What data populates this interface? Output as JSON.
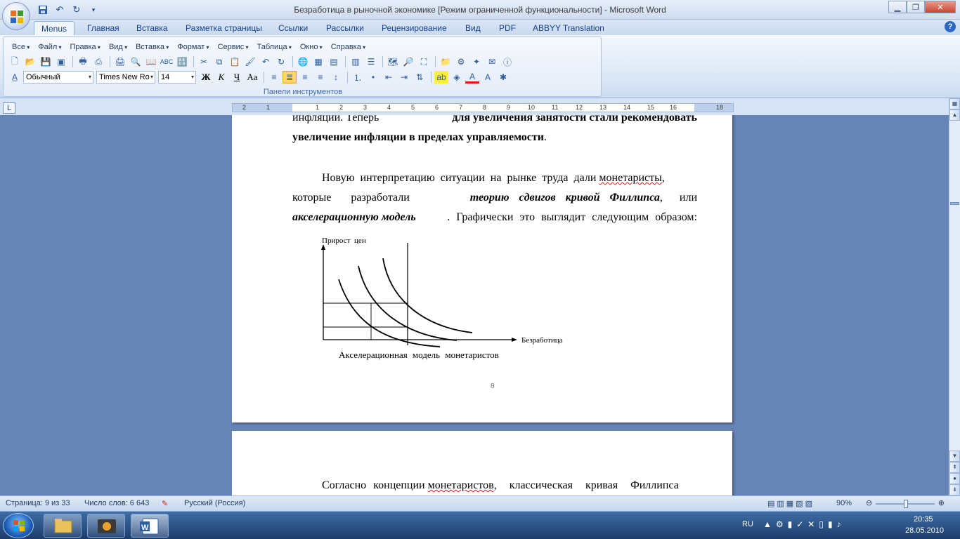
{
  "window": {
    "title": "Безработица в рыночной экономике [Режим ограниченной функциональности] - Microsoft Word"
  },
  "tabs": [
    {
      "label": "Menus"
    },
    {
      "label": "Главная"
    },
    {
      "label": "Вставка"
    },
    {
      "label": "Разметка страницы"
    },
    {
      "label": "Ссылки"
    },
    {
      "label": "Рассылки"
    },
    {
      "label": "Рецензирование"
    },
    {
      "label": "Вид"
    },
    {
      "label": "PDF"
    },
    {
      "label": "ABBYY Translation"
    }
  ],
  "menus": [
    "Все",
    "Файл",
    "Правка",
    "Вид",
    "Вставка",
    "Формат",
    "Сервис",
    "Таблица",
    "Окно",
    "Справка"
  ],
  "format_bar": {
    "style": "Обычный",
    "font": "Times New Ro",
    "size": "14"
  },
  "panel_label": "Панели инструментов",
  "ruler": {
    "left_numbers": [
      "2",
      "1",
      "1"
    ],
    "right_numbers": [
      "1",
      "2",
      "3",
      "4",
      "5",
      "6",
      "7",
      "8",
      "9",
      "10",
      "11",
      "12",
      "13",
      "14",
      "15",
      "16",
      "18"
    ]
  },
  "document": {
    "p1_line1_a": "инфляции. Теперь",
    "p1_line1_b": "для увеличения занятости стали рекомендовать",
    "p1_line2_a": "увеличение инфляции в пределах управляемости",
    "p1_line2_b": ".",
    "p2_l1_a": "Новую интерпретацию ситуации на рынке труда дали",
    "p2_l1_b": "монетаристы",
    "p2_l1_c": ",",
    "p2_l2_a": "которые разработали",
    "p2_l2_b": "теорию сдвигов кривой Филлипса",
    "p2_l2_c": ", или",
    "p2_l3_a": "акселерационную модель",
    "p2_l3_b": ". Графически это выглядит следующим образом:",
    "page_number": "8",
    "p3_a": "Согласно концепции",
    "p3_b": "монетаристов",
    "p3_c": ", классическая кривая Филлипса"
  },
  "chart_data": {
    "type": "line",
    "title": "",
    "caption": "Акселерационная модель монетаристов",
    "xlabel": "Безработица",
    "ylabel": "Прирост цен",
    "series": [
      {
        "values": []
      },
      {
        "values": []
      },
      {
        "values": []
      }
    ]
  },
  "statusbar": {
    "page": "Страница: 9 из 33",
    "words": "Число слов: 6 643",
    "language": "Русский (Россия)",
    "zoom": "90%"
  },
  "taskbar": {
    "lang": "RU",
    "time": "20:35",
    "date": "28.05.2010"
  }
}
